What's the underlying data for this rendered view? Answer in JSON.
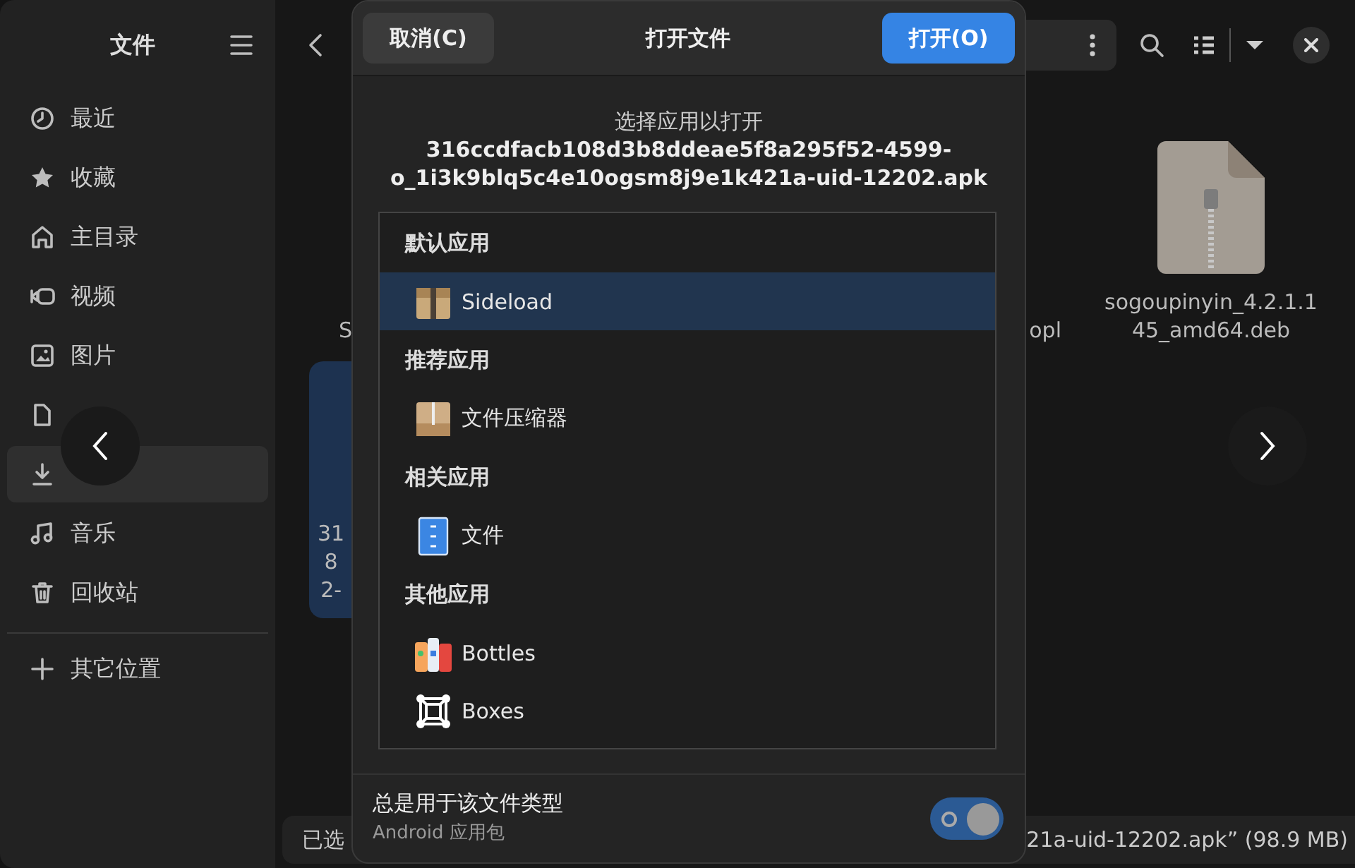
{
  "file_manager": {
    "sidebar": {
      "title": "文件",
      "items": [
        {
          "label": "最近",
          "selected": false
        },
        {
          "label": "收藏",
          "selected": false
        },
        {
          "label": "主目录",
          "selected": false
        },
        {
          "label": "视频",
          "selected": false
        },
        {
          "label": "图片",
          "selected": false
        },
        {
          "selected": false
        },
        {
          "selected": true
        },
        {
          "label": "音乐",
          "selected": false
        },
        {
          "label": "回收站",
          "selected": false
        }
      ],
      "other_locations": "其它位置"
    },
    "files": [
      {
        "lines": [
          "S"
        ],
        "selected": false
      },
      {
        "lines": [
          "opl"
        ],
        "selected": false
      },
      {
        "lines": [
          "sogoupinyin_4.2.1.1",
          "45_amd64.deb"
        ],
        "selected": false
      },
      {
        "lines": [
          "31",
          "8",
          "2-"
        ],
        "selected": true
      }
    ],
    "status_bar": {
      "left": "已选",
      "right": "21a-uid-12202.apk” (98.9 MB)"
    }
  },
  "dialog": {
    "cancel": "取消(C)",
    "title": "打开文件",
    "open": "打开(O)",
    "prompt": "选择应用以打开",
    "filename": [
      "316ccdfacb108d3b8ddeae5f8a295f52-4599-",
      "o_1i3k9blq5c4e10ogsm8j9e1k421a-uid-12202.apk"
    ],
    "sections": [
      {
        "heading": "默认应用",
        "apps": [
          {
            "name": "Sideload",
            "selected": true
          }
        ]
      },
      {
        "heading": "推荐应用",
        "apps": [
          {
            "name": "文件压缩器",
            "selected": false
          }
        ]
      },
      {
        "heading": "相关应用",
        "apps": [
          {
            "name": "文件",
            "selected": false
          }
        ]
      },
      {
        "heading": "其他应用",
        "apps": [
          {
            "name": "Bottles",
            "selected": false
          },
          {
            "name": "Boxes",
            "selected": false
          }
        ]
      }
    ],
    "always_use": {
      "label": "总是用于该文件类型",
      "sublabel": "Android 应用包",
      "on": true
    }
  }
}
